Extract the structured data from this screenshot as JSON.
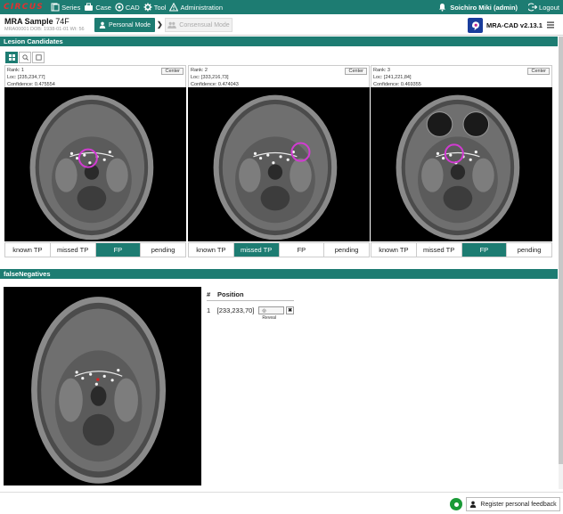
{
  "nav": {
    "logo": "CIRCUS",
    "items": [
      {
        "label": "Series",
        "icon": "series-icon"
      },
      {
        "label": "Case",
        "icon": "case-icon"
      },
      {
        "label": "CAD",
        "icon": "cad-icon"
      },
      {
        "label": "Tool",
        "icon": "tool-icon"
      },
      {
        "label": "Administration",
        "icon": "admin-icon"
      }
    ],
    "user": "Soichiro Miki (admin)",
    "logout": "Logout"
  },
  "header": {
    "series_name": "MRA Sample",
    "age_sex": "74F",
    "meta": "MRA00001  DOB: 1938-01-01  Wt: 56",
    "mode_active": "Personal Mode",
    "mode_inactive": "Consensual Mode",
    "plugin_name": "MRA-CAD v2.13.1"
  },
  "lesion_section": {
    "title": "Lesion Candidates",
    "toggles": [
      "grid-icon",
      "zoom-in-icon",
      "zoom-out-icon"
    ],
    "candidates": [
      {
        "rank": "Rank: 1",
        "loc": "Loc: [235,234,77]",
        "confidence": "Confidence: 0.475554",
        "center": "Center",
        "selected": "FP",
        "marker": [
          0.46,
          0.46
        ]
      },
      {
        "rank": "Rank: 2",
        "loc": "Loc: [333,216,73]",
        "confidence": "Confidence: 0.474043",
        "center": "Center",
        "selected": "missed TP",
        "marker": [
          0.62,
          0.42
        ]
      },
      {
        "rank": "Rank: 3",
        "loc": "Loc: [241,221,84]",
        "confidence": "Confidence: 0.469355",
        "center": "Center",
        "selected": "FP",
        "marker": [
          0.46,
          0.43
        ]
      }
    ],
    "feedback_options": [
      "known TP",
      "missed TP",
      "FP",
      "pending"
    ]
  },
  "fn_section": {
    "title": "falseNegatives",
    "col_num": "#",
    "col_pos": "Position",
    "rows": [
      {
        "num": "1",
        "pos": "[233,233,70]",
        "reveal": "Reveal"
      }
    ]
  },
  "footer": {
    "register": "Register personal feedback"
  }
}
